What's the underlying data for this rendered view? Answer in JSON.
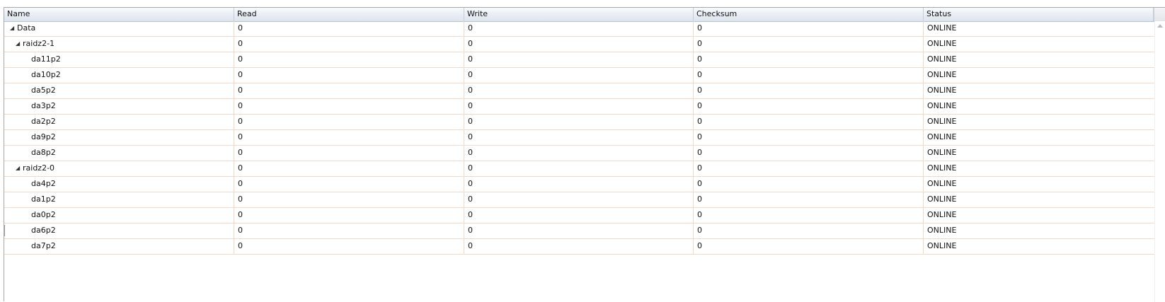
{
  "columns": [
    "Name",
    "Read",
    "Write",
    "Checksum",
    "Status"
  ],
  "rows": [
    {
      "name": "Data",
      "level": 0,
      "expander": "◢",
      "read": "0",
      "write": "0",
      "checksum": "0",
      "status": "ONLINE"
    },
    {
      "name": "raidz2-1",
      "level": 1,
      "expander": "◢",
      "read": "0",
      "write": "0",
      "checksum": "0",
      "status": "ONLINE"
    },
    {
      "name": "da11p2",
      "level": 2,
      "read": "0",
      "write": "0",
      "checksum": "0",
      "status": "ONLINE"
    },
    {
      "name": "da10p2",
      "level": 2,
      "read": "0",
      "write": "0",
      "checksum": "0",
      "status": "ONLINE"
    },
    {
      "name": "da5p2",
      "level": 2,
      "read": "0",
      "write": "0",
      "checksum": "0",
      "status": "ONLINE"
    },
    {
      "name": "da3p2",
      "level": 2,
      "read": "0",
      "write": "0",
      "checksum": "0",
      "status": "ONLINE"
    },
    {
      "name": "da2p2",
      "level": 2,
      "read": "0",
      "write": "0",
      "checksum": "0",
      "status": "ONLINE"
    },
    {
      "name": "da9p2",
      "level": 2,
      "read": "0",
      "write": "0",
      "checksum": "0",
      "status": "ONLINE"
    },
    {
      "name": "da8p2",
      "level": 2,
      "read": "0",
      "write": "0",
      "checksum": "0",
      "status": "ONLINE"
    },
    {
      "name": "raidz2-0",
      "level": 1,
      "expander": "◢",
      "read": "0",
      "write": "0",
      "checksum": "0",
      "status": "ONLINE"
    },
    {
      "name": "da4p2",
      "level": 2,
      "read": "0",
      "write": "0",
      "checksum": "0",
      "status": "ONLINE"
    },
    {
      "name": "da1p2",
      "level": 2,
      "read": "0",
      "write": "0",
      "checksum": "0",
      "status": "ONLINE"
    },
    {
      "name": "da0p2",
      "level": 2,
      "read": "0",
      "write": "0",
      "checksum": "0",
      "status": "ONLINE"
    },
    {
      "name": "da6p2",
      "level": 2,
      "read": "0",
      "write": "0",
      "checksum": "0",
      "status": "ONLINE"
    },
    {
      "name": "da7p2",
      "level": 2,
      "read": "0",
      "write": "0",
      "checksum": "0",
      "status": "ONLINE"
    }
  ]
}
